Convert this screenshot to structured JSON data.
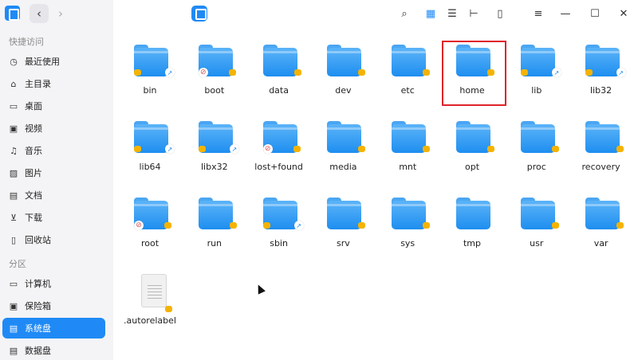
{
  "sidebar": {
    "quick_access_header": "快捷访问",
    "partition_header": "分区",
    "quick_items": [
      {
        "label": "最近使用",
        "icon": "clock-icon"
      },
      {
        "label": "主目录",
        "icon": "home-icon"
      },
      {
        "label": "桌面",
        "icon": "desktop-icon"
      },
      {
        "label": "视频",
        "icon": "video-icon"
      },
      {
        "label": "音乐",
        "icon": "music-icon"
      },
      {
        "label": "图片",
        "icon": "image-icon"
      },
      {
        "label": "文档",
        "icon": "document-icon"
      },
      {
        "label": "下载",
        "icon": "download-icon"
      },
      {
        "label": "回收站",
        "icon": "trash-icon"
      }
    ],
    "partition_items": [
      {
        "label": "计算机",
        "icon": "computer-icon"
      },
      {
        "label": "保险箱",
        "icon": "safe-icon"
      },
      {
        "label": "系统盘",
        "icon": "system-disk-icon",
        "active": true
      },
      {
        "label": "数据盘",
        "icon": "data-disk-icon"
      }
    ]
  },
  "topbar": {
    "back": "‹",
    "forward": "›",
    "search": "⌕",
    "view_grid": "▦",
    "view_list": "☰",
    "view_tree": "⊢",
    "details": "▯",
    "menu": "≡",
    "minimize": "—",
    "maximize": "☐",
    "close": "✕"
  },
  "files": [
    {
      "name": "bin",
      "badges": [
        "lock",
        "link"
      ]
    },
    {
      "name": "boot",
      "badges": [
        "noentry",
        "lock"
      ]
    },
    {
      "name": "data",
      "badges": [
        "lock"
      ]
    },
    {
      "name": "dev",
      "badges": [
        "lock"
      ]
    },
    {
      "name": "etc",
      "badges": [
        "lock"
      ]
    },
    {
      "name": "home",
      "badges": [
        "lock"
      ]
    },
    {
      "name": "lib",
      "badges": [
        "lock",
        "link"
      ]
    },
    {
      "name": "lib32",
      "badges": [
        "lock",
        "link"
      ]
    },
    {
      "name": "lib64",
      "badges": [
        "lock",
        "link"
      ]
    },
    {
      "name": "libx32",
      "badges": [
        "lock",
        "link"
      ]
    },
    {
      "name": "lost+found",
      "badges": [
        "noentry",
        "lock"
      ]
    },
    {
      "name": "media",
      "badges": [
        "lock"
      ]
    },
    {
      "name": "mnt",
      "badges": [
        "lock"
      ]
    },
    {
      "name": "opt",
      "badges": [
        "lock"
      ]
    },
    {
      "name": "proc",
      "badges": [
        "lock"
      ]
    },
    {
      "name": "recovery",
      "badges": [
        "lock"
      ]
    },
    {
      "name": "root",
      "badges": [
        "noentry",
        "lock"
      ]
    },
    {
      "name": "run",
      "badges": [
        "lock"
      ]
    },
    {
      "name": "sbin",
      "badges": [
        "lock",
        "link"
      ]
    },
    {
      "name": "srv",
      "badges": [
        "lock"
      ]
    },
    {
      "name": "sys",
      "badges": [
        "lock"
      ]
    },
    {
      "name": "tmp",
      "badges": []
    },
    {
      "name": "usr",
      "badges": [
        "lock"
      ]
    },
    {
      "name": "var",
      "badges": [
        "lock"
      ]
    },
    {
      "name": ".autorelabel",
      "type": "file",
      "badges": [
        "lock"
      ]
    }
  ],
  "colors": {
    "accent": "#1f8af5",
    "highlight": "#e0242a"
  }
}
